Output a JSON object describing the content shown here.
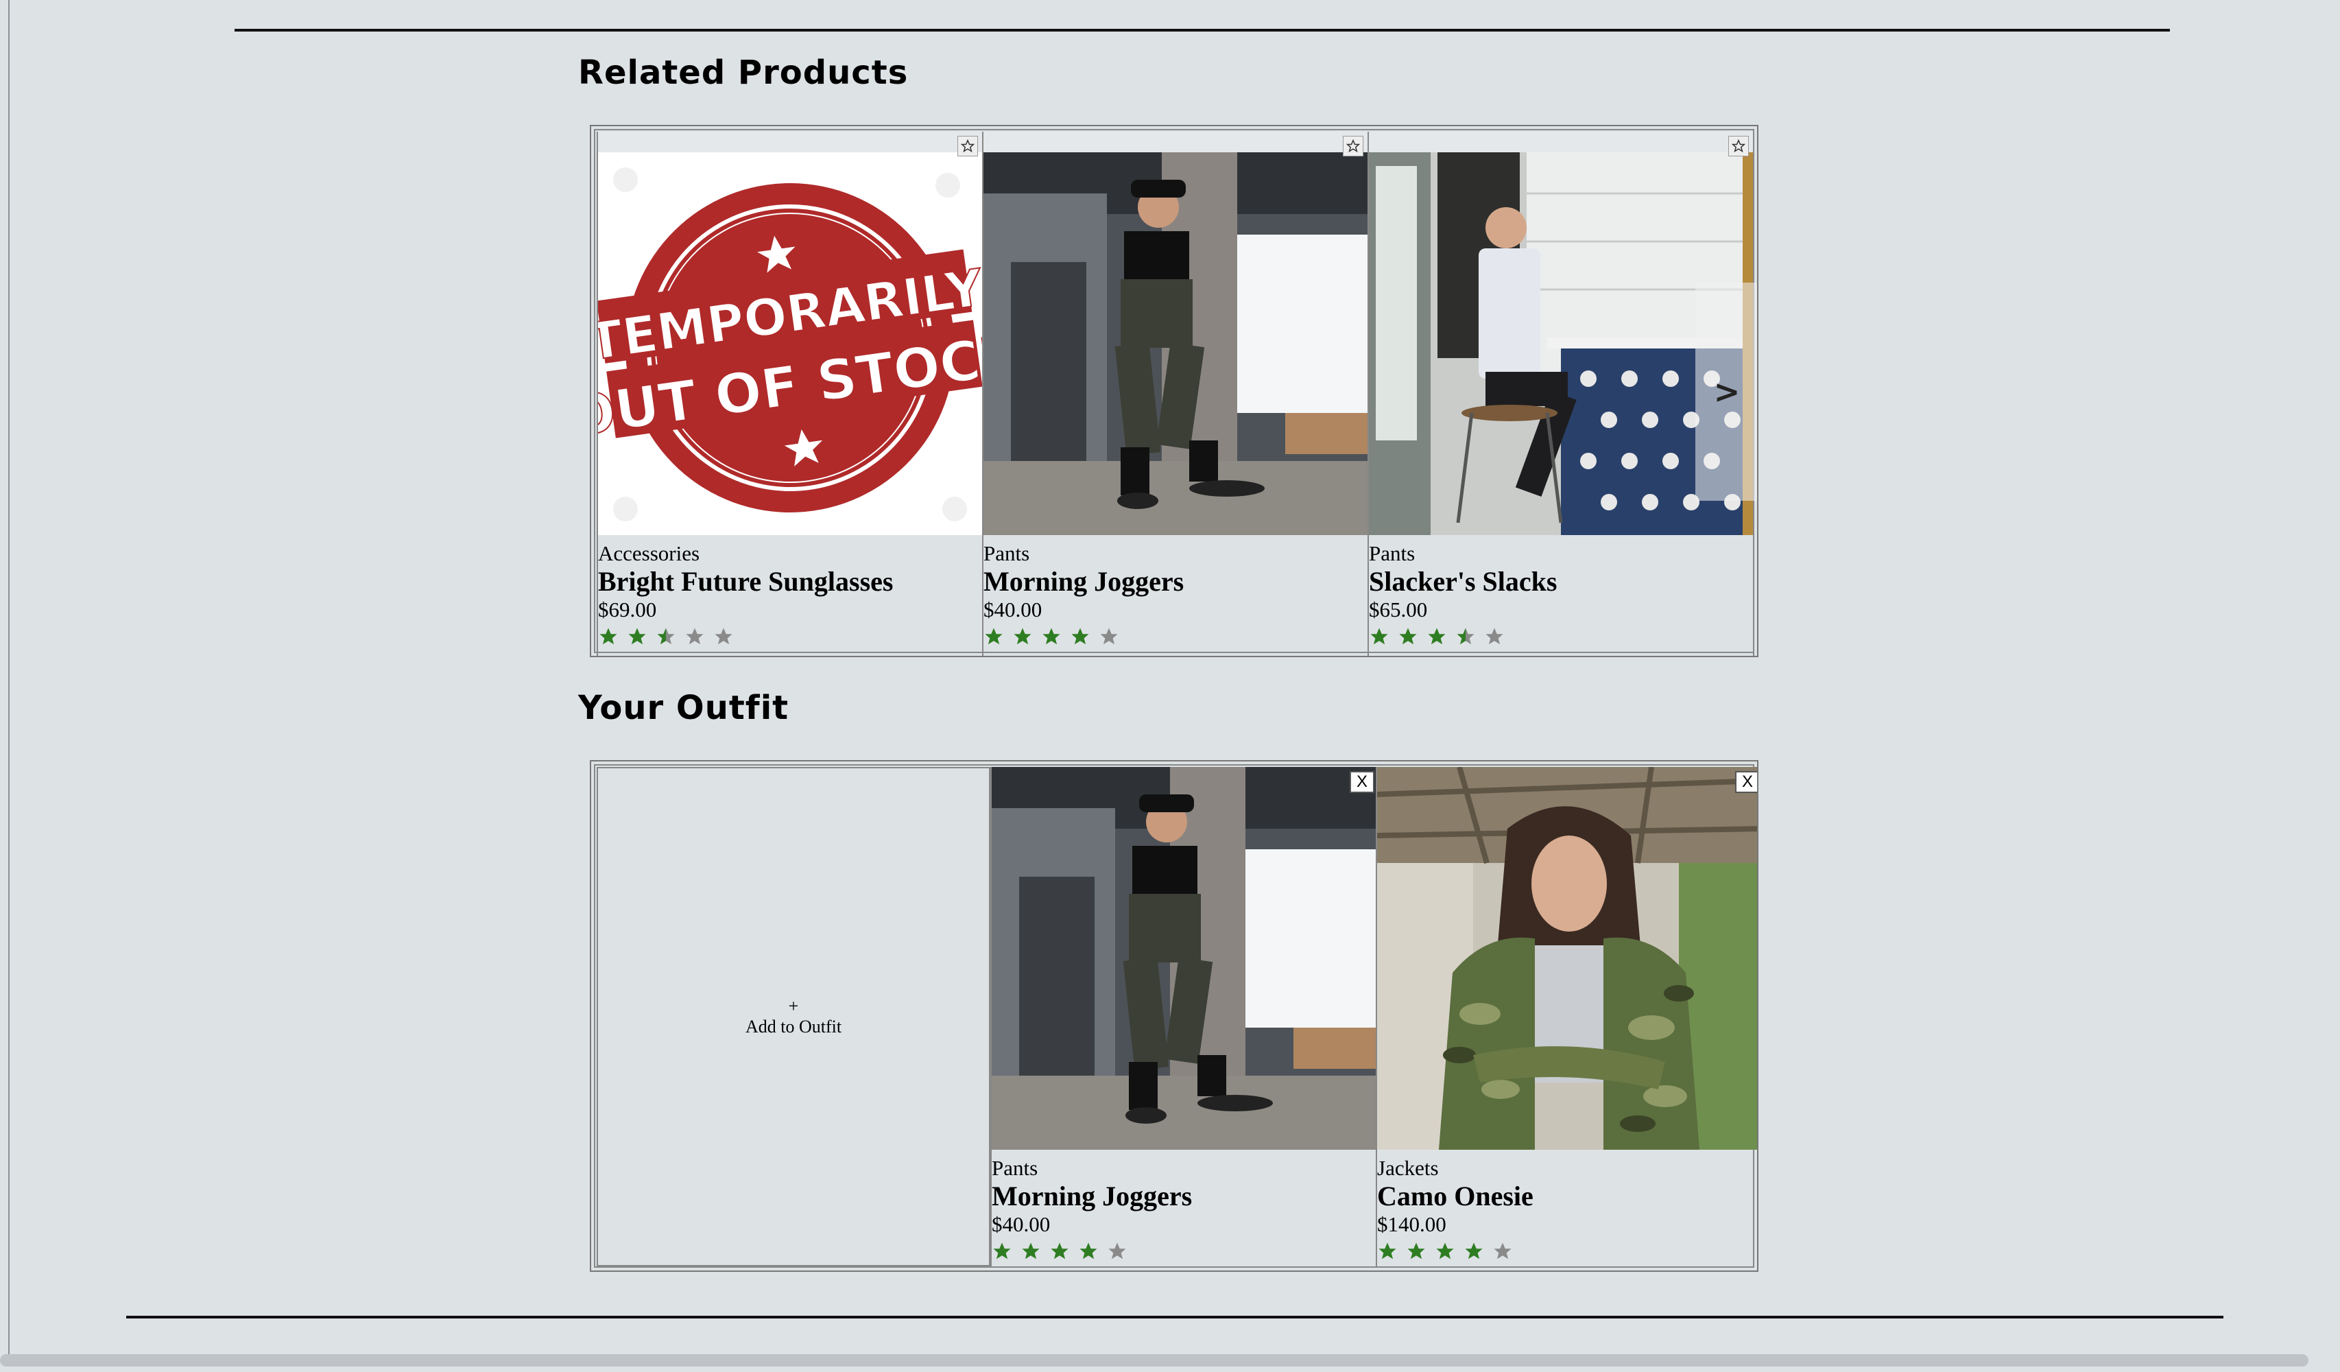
{
  "related": {
    "title": "Related Products",
    "next_label": ">",
    "cards": [
      {
        "category": "Accessories",
        "name": "Bright Future Sunglasses",
        "price": "$69.00",
        "rating": 2.5,
        "image": "out-of-stock-stamp",
        "stamp_line1": "TEMPORARILY",
        "stamp_line2": "OUT OF STOCK"
      },
      {
        "category": "Pants",
        "name": "Morning Joggers",
        "price": "$40.00",
        "rating": 4,
        "image": "woman-in-joggers-photo"
      },
      {
        "category": "Pants",
        "name": "Slacker's Slacks",
        "price": "$65.00",
        "rating": 3.5,
        "image": "man-in-cafe-photo"
      }
    ]
  },
  "outfit": {
    "title": "Your Outfit",
    "add_plus": "+",
    "add_label": "Add to Outfit",
    "remove_label": "X",
    "cards": [
      {
        "category": "Pants",
        "name": "Morning Joggers",
        "price": "$40.00",
        "rating": 4,
        "image": "woman-in-joggers-photo"
      },
      {
        "category": "Jackets",
        "name": "Camo Onesie",
        "price": "$140.00",
        "rating": 4,
        "image": "woman-in-camo-jacket-photo"
      }
    ]
  },
  "colors": {
    "star_filled": "#2e7d22",
    "star_empty": "#8a8a8a",
    "background": "#dde2e5",
    "stamp_red": "#b02a2a"
  }
}
